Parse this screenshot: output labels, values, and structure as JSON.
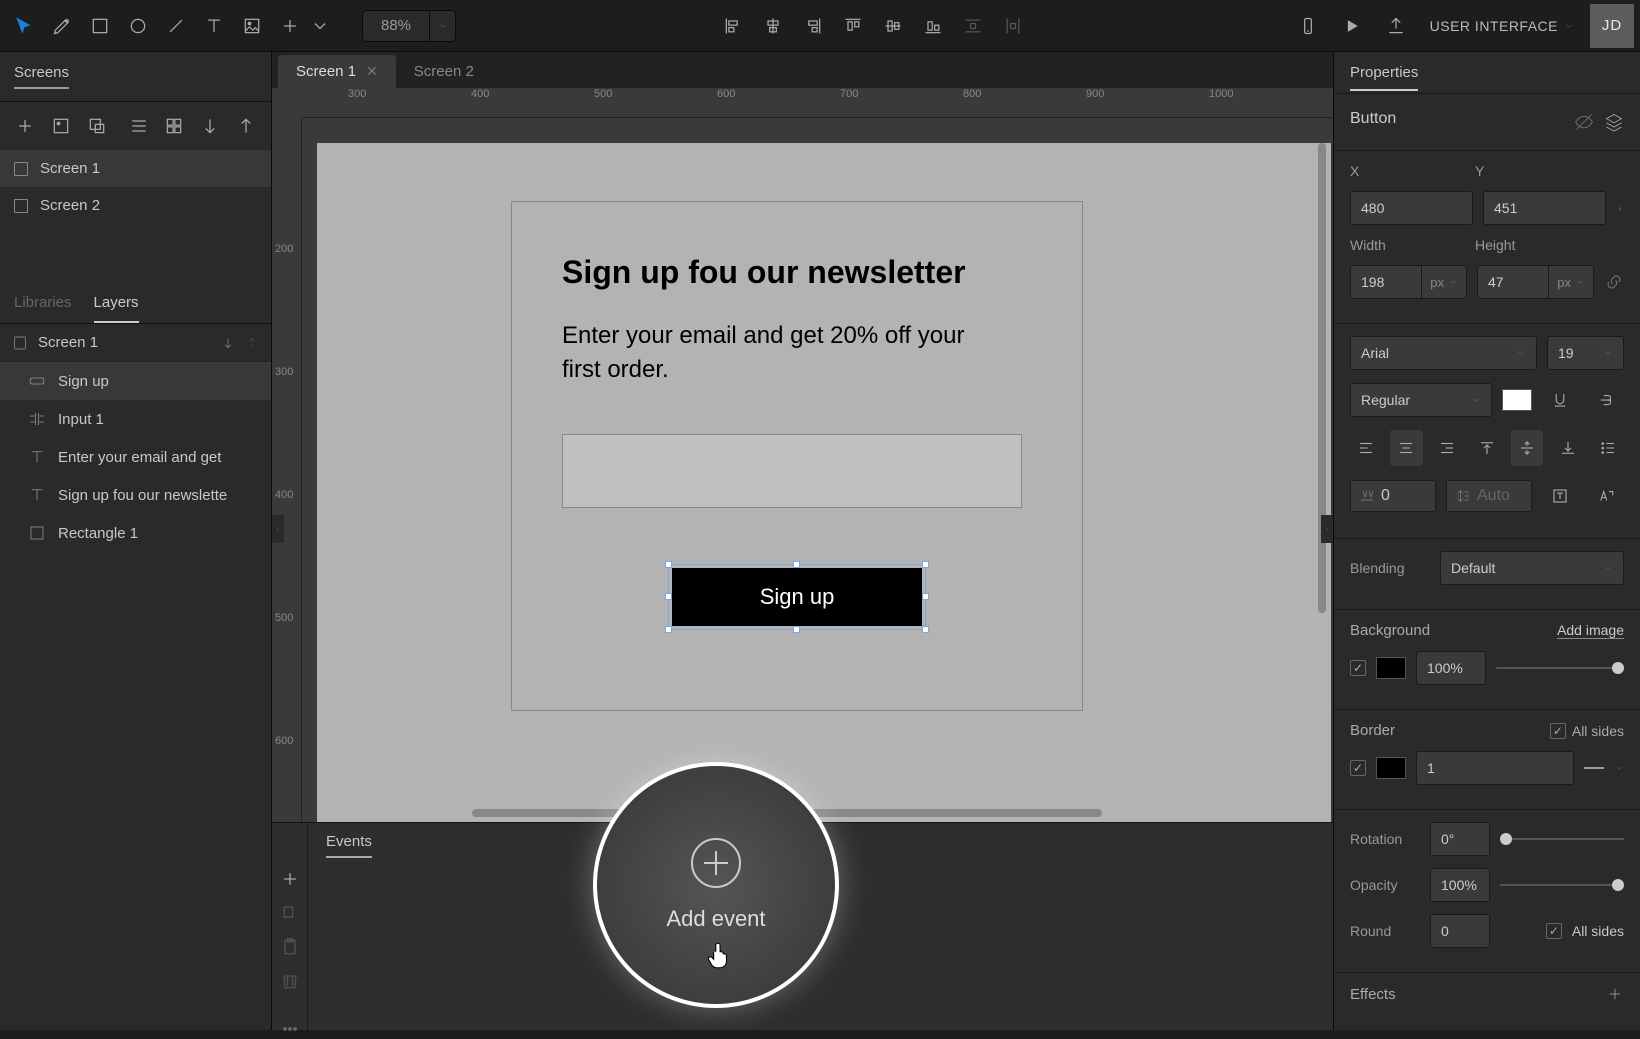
{
  "toolbar": {
    "zoom": "88%",
    "mode_label": "USER INTERFACE",
    "avatar_initials": "JD"
  },
  "screens_panel": {
    "title": "Screens",
    "items": [
      "Screen 1",
      "Screen 2"
    ]
  },
  "layers_panel": {
    "tabs": {
      "libraries": "Libraries",
      "layers": "Layers"
    },
    "root": "Screen 1",
    "items": [
      {
        "icon": "button",
        "label": "Sign up"
      },
      {
        "icon": "input",
        "label": "Input 1"
      },
      {
        "icon": "text",
        "label": "Enter your email and get"
      },
      {
        "icon": "text",
        "label": "Sign up fou our newslette"
      },
      {
        "icon": "rect",
        "label": "Rectangle 1"
      }
    ]
  },
  "tabs": {
    "items": [
      {
        "label": "Screen 1",
        "active": true,
        "closable": true
      },
      {
        "label": "Screen 2",
        "active": false,
        "closable": false
      }
    ]
  },
  "ruler_h": [
    300,
    400,
    500,
    600,
    700,
    800,
    900,
    1000
  ],
  "ruler_v": [
    200,
    300,
    400,
    500,
    600
  ],
  "canvas": {
    "heading": "Sign up fou our newsletter",
    "body": "Enter your email and get 20% off your first order.",
    "button_label": "Sign up"
  },
  "events": {
    "tab": "Events",
    "add_label": "Add event"
  },
  "properties": {
    "title": "Properties",
    "element_type": "Button",
    "x_label": "X",
    "y_label": "Y",
    "x": "480",
    "y": "451",
    "w_label": "Width",
    "h_label": "Height",
    "w": "198",
    "w_unit": "px",
    "h": "47",
    "h_unit": "px",
    "font_family": "Arial",
    "font_size": "19",
    "font_weight": "Regular",
    "letter_spacing": "0",
    "line_height": "Auto",
    "blending_label": "Blending",
    "blending_value": "Default",
    "background_label": "Background",
    "add_image": "Add image",
    "bg_opacity": "100%",
    "border_label": "Border",
    "all_sides": "All sides",
    "border_width": "1",
    "rotation_label": "Rotation",
    "rotation_value": "0°",
    "opacity_label": "Opacity",
    "opacity_value": "100%",
    "round_label": "Round",
    "round_value": "0",
    "round_all_sides": "All sides",
    "effects_label": "Effects"
  }
}
